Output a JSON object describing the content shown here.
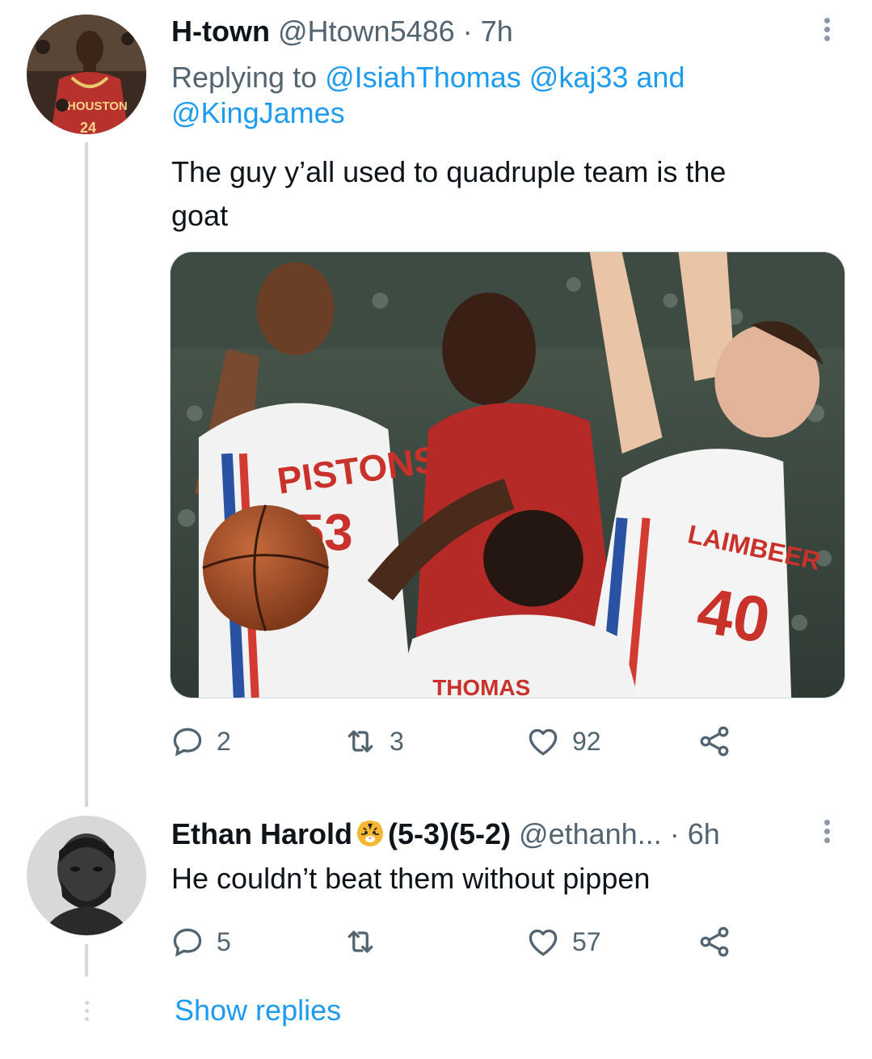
{
  "tweet1": {
    "name": "H-town",
    "handle": "@Htown5486",
    "separator": "·",
    "time": "7h",
    "replying_prefix": "Replying to",
    "replying_to": [
      "@IsiahThomas",
      "@kaj33",
      "and",
      "@KingJames"
    ],
    "text_line1": "The guy y’all used to quadruple team is the",
    "text_line2": "goat",
    "avatar_jersey_text": "HOUSTON",
    "avatar_jersey_number": "24",
    "photo": {
      "jersey_text_left": "PISTONS",
      "jersey_number_left": "53",
      "jersey_text_right": "LAIMBEER",
      "jersey_number_right": "40",
      "jersey_text_bottom": "THOMAS"
    },
    "actions": {
      "reply_count": "2",
      "retweet_count": "3",
      "like_count": "92"
    }
  },
  "tweet2": {
    "name_part1": "Ethan Harold",
    "name_part2": "(5-3)(5-2)",
    "handle": "@ethanh...",
    "separator": "·",
    "time": "6h",
    "text": "He couldn’t beat them without pippen",
    "actions": {
      "reply_count": "5",
      "retweet_count": "",
      "like_count": "57"
    }
  },
  "show_replies": "Show replies",
  "colors": {
    "link": "#1d9bf0",
    "secondary_text": "#536471",
    "primary_text": "#0f1419",
    "thread_line": "#cfd9de"
  }
}
